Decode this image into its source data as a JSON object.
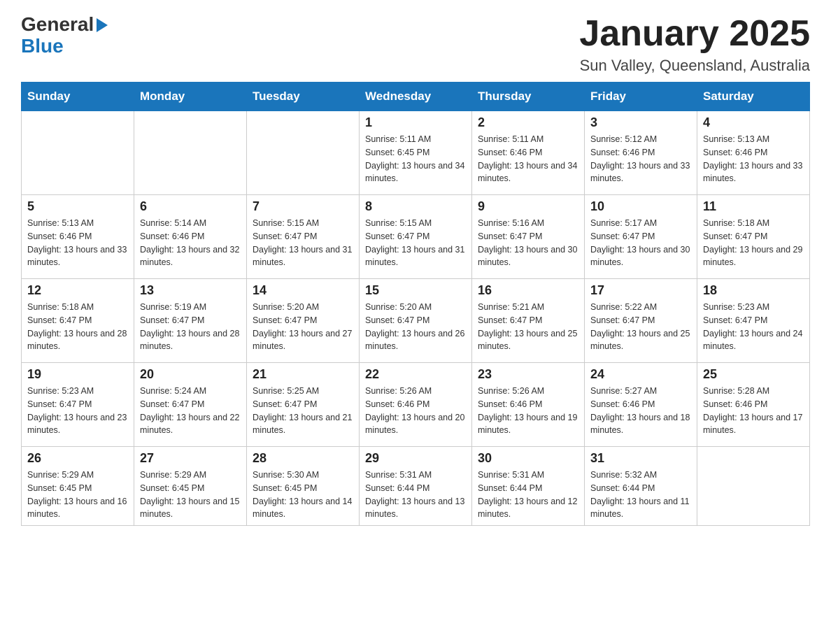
{
  "logo": {
    "line1": "General",
    "arrow": "▶",
    "line2": "Blue"
  },
  "title": "January 2025",
  "subtitle": "Sun Valley, Queensland, Australia",
  "days_header": [
    "Sunday",
    "Monday",
    "Tuesday",
    "Wednesday",
    "Thursday",
    "Friday",
    "Saturday"
  ],
  "weeks": [
    [
      {
        "day": "",
        "info": ""
      },
      {
        "day": "",
        "info": ""
      },
      {
        "day": "",
        "info": ""
      },
      {
        "day": "1",
        "sunrise": "Sunrise: 5:11 AM",
        "sunset": "Sunset: 6:45 PM",
        "daylight": "Daylight: 13 hours and 34 minutes."
      },
      {
        "day": "2",
        "sunrise": "Sunrise: 5:11 AM",
        "sunset": "Sunset: 6:46 PM",
        "daylight": "Daylight: 13 hours and 34 minutes."
      },
      {
        "day": "3",
        "sunrise": "Sunrise: 5:12 AM",
        "sunset": "Sunset: 6:46 PM",
        "daylight": "Daylight: 13 hours and 33 minutes."
      },
      {
        "day": "4",
        "sunrise": "Sunrise: 5:13 AM",
        "sunset": "Sunset: 6:46 PM",
        "daylight": "Daylight: 13 hours and 33 minutes."
      }
    ],
    [
      {
        "day": "5",
        "sunrise": "Sunrise: 5:13 AM",
        "sunset": "Sunset: 6:46 PM",
        "daylight": "Daylight: 13 hours and 33 minutes."
      },
      {
        "day": "6",
        "sunrise": "Sunrise: 5:14 AM",
        "sunset": "Sunset: 6:46 PM",
        "daylight": "Daylight: 13 hours and 32 minutes."
      },
      {
        "day": "7",
        "sunrise": "Sunrise: 5:15 AM",
        "sunset": "Sunset: 6:47 PM",
        "daylight": "Daylight: 13 hours and 31 minutes."
      },
      {
        "day": "8",
        "sunrise": "Sunrise: 5:15 AM",
        "sunset": "Sunset: 6:47 PM",
        "daylight": "Daylight: 13 hours and 31 minutes."
      },
      {
        "day": "9",
        "sunrise": "Sunrise: 5:16 AM",
        "sunset": "Sunset: 6:47 PM",
        "daylight": "Daylight: 13 hours and 30 minutes."
      },
      {
        "day": "10",
        "sunrise": "Sunrise: 5:17 AM",
        "sunset": "Sunset: 6:47 PM",
        "daylight": "Daylight: 13 hours and 30 minutes."
      },
      {
        "day": "11",
        "sunrise": "Sunrise: 5:18 AM",
        "sunset": "Sunset: 6:47 PM",
        "daylight": "Daylight: 13 hours and 29 minutes."
      }
    ],
    [
      {
        "day": "12",
        "sunrise": "Sunrise: 5:18 AM",
        "sunset": "Sunset: 6:47 PM",
        "daylight": "Daylight: 13 hours and 28 minutes."
      },
      {
        "day": "13",
        "sunrise": "Sunrise: 5:19 AM",
        "sunset": "Sunset: 6:47 PM",
        "daylight": "Daylight: 13 hours and 28 minutes."
      },
      {
        "day": "14",
        "sunrise": "Sunrise: 5:20 AM",
        "sunset": "Sunset: 6:47 PM",
        "daylight": "Daylight: 13 hours and 27 minutes."
      },
      {
        "day": "15",
        "sunrise": "Sunrise: 5:20 AM",
        "sunset": "Sunset: 6:47 PM",
        "daylight": "Daylight: 13 hours and 26 minutes."
      },
      {
        "day": "16",
        "sunrise": "Sunrise: 5:21 AM",
        "sunset": "Sunset: 6:47 PM",
        "daylight": "Daylight: 13 hours and 25 minutes."
      },
      {
        "day": "17",
        "sunrise": "Sunrise: 5:22 AM",
        "sunset": "Sunset: 6:47 PM",
        "daylight": "Daylight: 13 hours and 25 minutes."
      },
      {
        "day": "18",
        "sunrise": "Sunrise: 5:23 AM",
        "sunset": "Sunset: 6:47 PM",
        "daylight": "Daylight: 13 hours and 24 minutes."
      }
    ],
    [
      {
        "day": "19",
        "sunrise": "Sunrise: 5:23 AM",
        "sunset": "Sunset: 6:47 PM",
        "daylight": "Daylight: 13 hours and 23 minutes."
      },
      {
        "day": "20",
        "sunrise": "Sunrise: 5:24 AM",
        "sunset": "Sunset: 6:47 PM",
        "daylight": "Daylight: 13 hours and 22 minutes."
      },
      {
        "day": "21",
        "sunrise": "Sunrise: 5:25 AM",
        "sunset": "Sunset: 6:47 PM",
        "daylight": "Daylight: 13 hours and 21 minutes."
      },
      {
        "day": "22",
        "sunrise": "Sunrise: 5:26 AM",
        "sunset": "Sunset: 6:46 PM",
        "daylight": "Daylight: 13 hours and 20 minutes."
      },
      {
        "day": "23",
        "sunrise": "Sunrise: 5:26 AM",
        "sunset": "Sunset: 6:46 PM",
        "daylight": "Daylight: 13 hours and 19 minutes."
      },
      {
        "day": "24",
        "sunrise": "Sunrise: 5:27 AM",
        "sunset": "Sunset: 6:46 PM",
        "daylight": "Daylight: 13 hours and 18 minutes."
      },
      {
        "day": "25",
        "sunrise": "Sunrise: 5:28 AM",
        "sunset": "Sunset: 6:46 PM",
        "daylight": "Daylight: 13 hours and 17 minutes."
      }
    ],
    [
      {
        "day": "26",
        "sunrise": "Sunrise: 5:29 AM",
        "sunset": "Sunset: 6:45 PM",
        "daylight": "Daylight: 13 hours and 16 minutes."
      },
      {
        "day": "27",
        "sunrise": "Sunrise: 5:29 AM",
        "sunset": "Sunset: 6:45 PM",
        "daylight": "Daylight: 13 hours and 15 minutes."
      },
      {
        "day": "28",
        "sunrise": "Sunrise: 5:30 AM",
        "sunset": "Sunset: 6:45 PM",
        "daylight": "Daylight: 13 hours and 14 minutes."
      },
      {
        "day": "29",
        "sunrise": "Sunrise: 5:31 AM",
        "sunset": "Sunset: 6:44 PM",
        "daylight": "Daylight: 13 hours and 13 minutes."
      },
      {
        "day": "30",
        "sunrise": "Sunrise: 5:31 AM",
        "sunset": "Sunset: 6:44 PM",
        "daylight": "Daylight: 13 hours and 12 minutes."
      },
      {
        "day": "31",
        "sunrise": "Sunrise: 5:32 AM",
        "sunset": "Sunset: 6:44 PM",
        "daylight": "Daylight: 13 hours and 11 minutes."
      },
      {
        "day": "",
        "info": ""
      }
    ]
  ]
}
